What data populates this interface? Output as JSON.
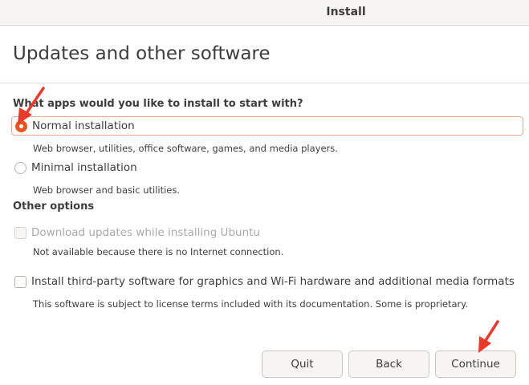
{
  "window": {
    "title": "Install"
  },
  "page": {
    "title": "Updates and other software"
  },
  "install_type": {
    "question": "What apps would you like to install to start with?",
    "options": [
      {
        "label": "Normal installation",
        "description": "Web browser, utilities, office software, games, and media players.",
        "selected": true
      },
      {
        "label": "Minimal installation",
        "description": "Web browser and basic utilities.",
        "selected": false
      }
    ]
  },
  "other_options": {
    "heading": "Other options",
    "items": [
      {
        "label": "Download updates while installing Ubuntu",
        "description": "Not available because there is no Internet connection.",
        "checked": false,
        "enabled": false
      },
      {
        "label": "Install third-party software for graphics and Wi-Fi hardware and additional media formats",
        "description": "This software is subject to license terms included with its documentation. Some is proprietary.",
        "checked": false,
        "enabled": true
      }
    ]
  },
  "buttons": {
    "quit": "Quit",
    "back": "Back",
    "continue": "Continue"
  },
  "colors": {
    "accent": "#e95420",
    "annotation_arrow": "#e8392a",
    "focus_border": "#e9a995"
  }
}
